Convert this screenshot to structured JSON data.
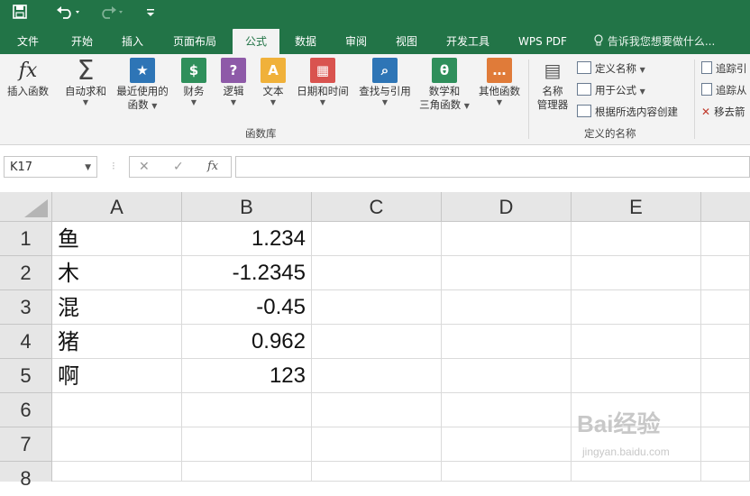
{
  "quick_access": {
    "save_icon": "save-icon",
    "undo_icon": "undo-icon",
    "redo_icon": "redo-icon",
    "customize_icon": "customize-icon"
  },
  "tabs": [
    "文件",
    "开始",
    "插入",
    "页面布局",
    "公式",
    "数据",
    "审阅",
    "视图",
    "开发工具",
    "WPS PDF"
  ],
  "active_tab": "公式",
  "tell_me": "告诉我您想要做什么...",
  "ribbon": {
    "insert_function": "插入函数",
    "autosum": "自动求和",
    "recent_line1": "最近使用的",
    "recent_line2": "函数",
    "financial": "财务",
    "logical": "逻辑",
    "text": "文本",
    "datetime": "日期和时间",
    "lookup": "查找与引用",
    "math_line1": "数学和",
    "math_line2": "三角函数",
    "more": "其他函数",
    "group_library": "函数库",
    "name_manager_line1": "名称",
    "name_manager_line2": "管理器",
    "define_name": "定义名称",
    "use_in_formula": "用于公式",
    "create_from_selection": "根据所选内容创建",
    "group_defined_names": "定义的名称",
    "trace_precedents": "追踪引",
    "trace_dependents": "追踪从",
    "remove_arrows": "移去箭"
  },
  "formula_bar": {
    "name_box": "K17",
    "cancel": "✕",
    "enter": "✓",
    "fx": "fx",
    "formula": ""
  },
  "columns": [
    "A",
    "B",
    "C",
    "D",
    "E"
  ],
  "rows": [
    "1",
    "2",
    "3",
    "4",
    "5",
    "6",
    "7",
    "8"
  ],
  "cells": {
    "A": [
      "鱼",
      "木",
      "混",
      "猪",
      "啊"
    ],
    "B": [
      "1.234",
      "-1.2345",
      "-0.45",
      "0.962",
      "123"
    ]
  },
  "watermark": {
    "main": "Bai经验",
    "sub": "jingyan.baidu.com"
  },
  "colors": {
    "excel_green": "#227447",
    "ribbon_bg": "#f3f3f3",
    "header_bg": "#e6e6e6"
  }
}
